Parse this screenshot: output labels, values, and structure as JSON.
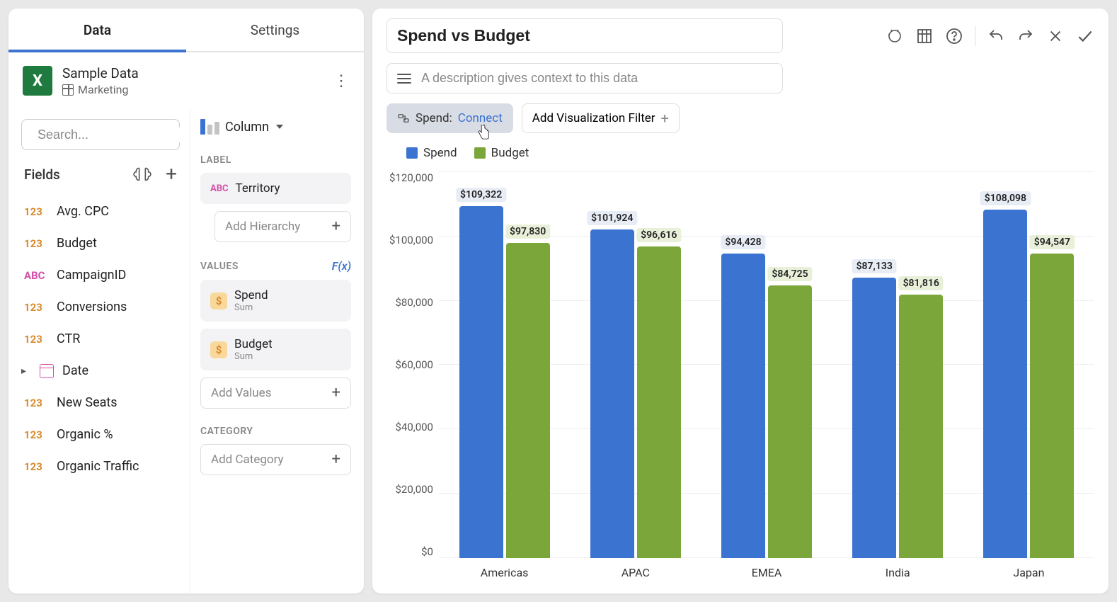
{
  "tabs": {
    "data": "Data",
    "settings": "Settings"
  },
  "datasource": {
    "name": "Sample Data",
    "table": "Marketing"
  },
  "search": {
    "placeholder": "Search..."
  },
  "fields": {
    "header": "Fields"
  },
  "field_list": [
    {
      "type": "123",
      "name": "Avg. CPC"
    },
    {
      "type": "123",
      "name": "Budget"
    },
    {
      "type": "ABC",
      "name": "CampaignID"
    },
    {
      "type": "123",
      "name": "Conversions"
    },
    {
      "type": "123",
      "name": "CTR"
    },
    {
      "type": "DATE",
      "name": "Date"
    },
    {
      "type": "123",
      "name": "New Seats"
    },
    {
      "type": "123",
      "name": "Organic %"
    },
    {
      "type": "123",
      "name": "Organic Traffic"
    }
  ],
  "chart_type": "Column",
  "sections": {
    "label": "LABEL",
    "values": "VALUES",
    "fx": "F(x)",
    "category": "CATEGORY"
  },
  "pills": {
    "territory": "Territory",
    "spend": "Spend",
    "budget": "Budget",
    "sum": "Sum"
  },
  "adders": {
    "hierarchy": "Add Hierarchy",
    "values": "Add Values",
    "category": "Add Category"
  },
  "title": "Spend vs Budget",
  "description": {
    "placeholder": "A description gives context to this data"
  },
  "filter_pill": {
    "field": "Spend:",
    "action": "Connect"
  },
  "add_filter": "Add Visualization Filter",
  "legend": {
    "spend": "Spend",
    "budget": "Budget"
  },
  "y_ticks": [
    "$120,000",
    "$100,000",
    "$80,000",
    "$60,000",
    "$40,000",
    "$20,000",
    "$0"
  ],
  "colors": {
    "blue": "#3b73d1",
    "green": "#7aa63a"
  },
  "chart_data": {
    "type": "bar",
    "title": "Spend vs Budget",
    "ylim": [
      0,
      120000
    ],
    "categories": [
      "Americas",
      "APAC",
      "EMEA",
      "India",
      "Japan"
    ],
    "series": [
      {
        "name": "Spend",
        "values": [
          109322,
          101924,
          94428,
          87133,
          108098
        ],
        "labels": [
          "$109,322",
          "$101,924",
          "$94,428",
          "$87,133",
          "$108,098"
        ]
      },
      {
        "name": "Budget",
        "values": [
          97830,
          96616,
          84725,
          81816,
          94547
        ],
        "labels": [
          "$97,830",
          "$96,616",
          "$84,725",
          "$81,816",
          "$94,547"
        ]
      }
    ]
  }
}
